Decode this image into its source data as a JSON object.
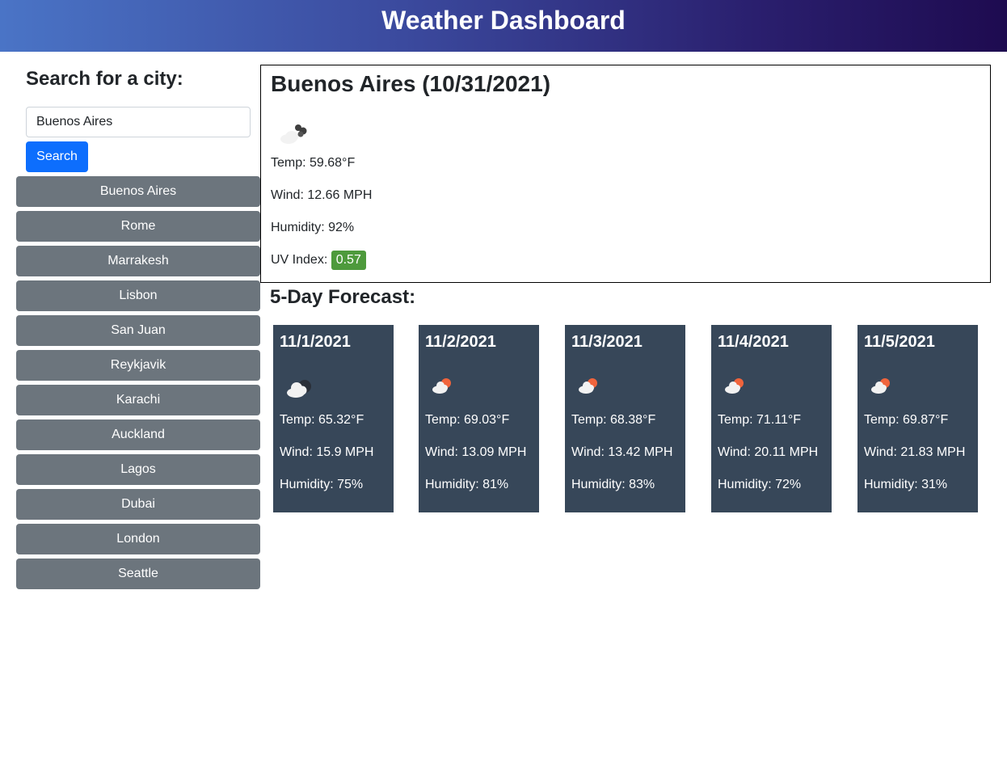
{
  "header": {
    "title": "Weather Dashboard"
  },
  "search": {
    "title": "Search for a city:",
    "input_value": "Buenos Aires",
    "button_label": "Search"
  },
  "history": [
    "Buenos Aires",
    "Rome",
    "Marrakesh",
    "Lisbon",
    "San Juan",
    "Reykjavik",
    "Karachi",
    "Auckland",
    "Lagos",
    "Dubai",
    "London",
    "Seattle"
  ],
  "current": {
    "title": "Buenos Aires (10/31/2021)",
    "icon": "cloudy-icon",
    "temp": "Temp: 59.68°F",
    "wind": "Wind: 12.66 MPH",
    "humidity": "Humidity: 92%",
    "uv_label": "UV Index: ",
    "uv_value": "0.57",
    "uv_color": "#4e9a3c"
  },
  "forecast": {
    "title": "5-Day Forecast:",
    "days": [
      {
        "date": "11/1/2021",
        "icon": "cloudy-night-icon",
        "temp": "Temp: 65.32°F",
        "wind": "Wind: 15.9 MPH",
        "humidity": "Humidity: 75%"
      },
      {
        "date": "11/2/2021",
        "icon": "partly-cloudy-icon",
        "temp": "Temp: 69.03°F",
        "wind": "Wind: 13.09 MPH",
        "humidity": "Humidity: 81%"
      },
      {
        "date": "11/3/2021",
        "icon": "partly-cloudy-icon",
        "temp": "Temp: 68.38°F",
        "wind": "Wind: 13.42 MPH",
        "humidity": "Humidity: 83%"
      },
      {
        "date": "11/4/2021",
        "icon": "partly-cloudy-icon",
        "temp": "Temp: 71.11°F",
        "wind": "Wind: 20.11 MPH",
        "humidity": "Humidity: 72%"
      },
      {
        "date": "11/5/2021",
        "icon": "partly-cloudy-icon",
        "temp": "Temp: 69.87°F",
        "wind": "Wind: 21.83 MPH",
        "humidity": "Humidity: 31%"
      }
    ]
  },
  "colors": {
    "header_start": "#4a74c6",
    "header_end": "#1e0b50",
    "primary_button": "#0d6efd",
    "history_button": "#6c757d",
    "forecast_card": "#374759",
    "sun": "#f0643c"
  }
}
